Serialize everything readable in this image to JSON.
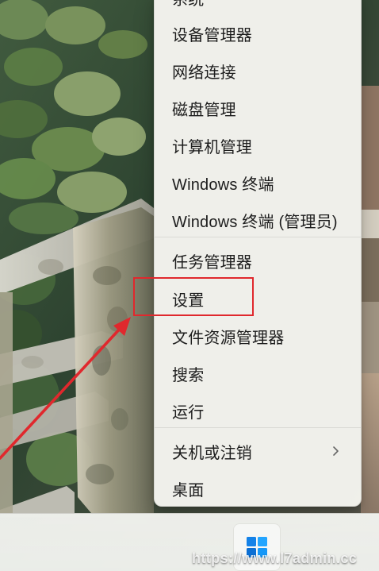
{
  "menu": {
    "items": {
      "cut_top": "系统",
      "device_manager": "设备管理器",
      "network_connections": "网络连接",
      "disk_management": "磁盘管理",
      "computer_management": "计算机管理",
      "windows_terminal": "Windows 终端",
      "windows_terminal_admin": "Windows 终端 (管理员)",
      "task_manager": "任务管理器",
      "settings": "设置",
      "file_explorer": "文件资源管理器",
      "search": "搜索",
      "run": "运行",
      "shutdown_signout": "关机或注销",
      "desktop": "桌面"
    },
    "submenu_chevron": "chevron-right-icon"
  },
  "overlay": {
    "highlight_color": "#e0282d",
    "watermark": "https://www.l7admin.cc"
  },
  "taskbar": {
    "start_icon": "windows-logo-icon"
  }
}
